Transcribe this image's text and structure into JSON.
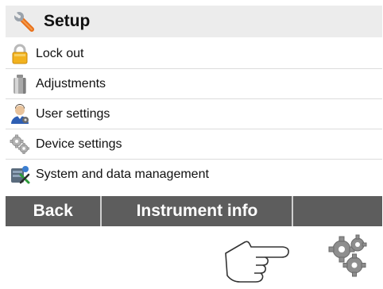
{
  "header": {
    "title": "Setup",
    "icon": "wrench-icon"
  },
  "menu": {
    "items": [
      {
        "label": "Lock out",
        "icon": "padlock-icon"
      },
      {
        "label": "Adjustments",
        "icon": "weight-icon"
      },
      {
        "label": "User settings",
        "icon": "user-icon"
      },
      {
        "label": "Device settings",
        "icon": "gear-icon"
      },
      {
        "label": "System and data management",
        "icon": "system-data-icon"
      }
    ]
  },
  "bottom_bar": {
    "back_label": "Back",
    "info_label": "Instrument info",
    "background": "#5d5d5d"
  },
  "below": {
    "pointer_icon": "pointing-hand-icon",
    "settings_icon": "gears-icon"
  },
  "colors": {
    "header_background": "#ececec",
    "wrench_orange": "#e8701a",
    "padlock_gold": "#f2b21e"
  }
}
